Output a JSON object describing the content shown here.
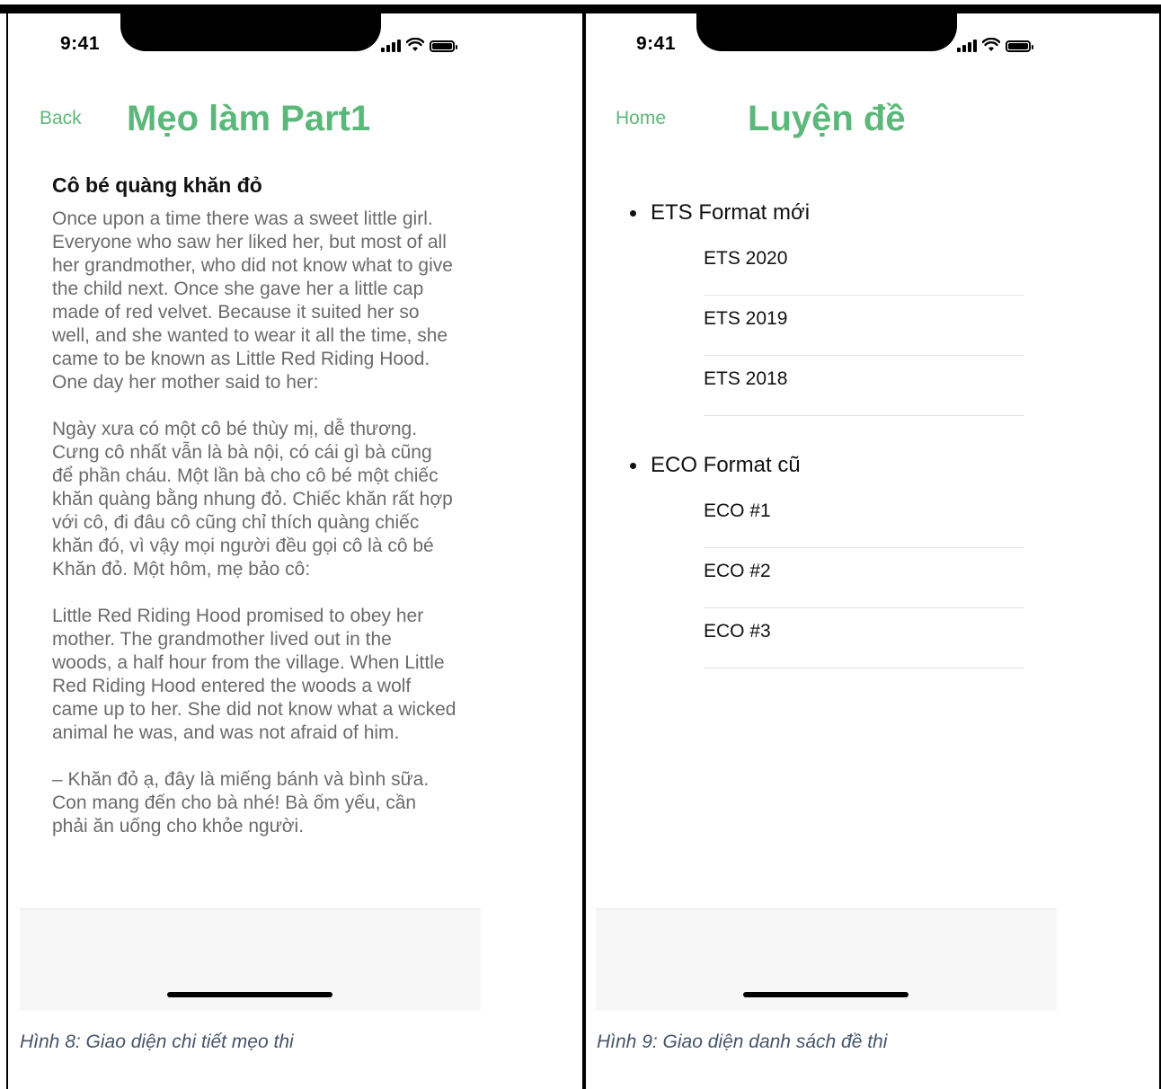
{
  "left_screen": {
    "status_time": "9:41",
    "nav_back_label": "Back",
    "nav_title": "Mẹo làm Part1",
    "article_title": "Cô bé quàng khăn đỏ",
    "paragraphs": [
      "Once upon a time there was a sweet little girl. Everyone who saw her liked her, but most of all her grandmother, who did not know what to give the child next. Once she gave her a little cap made of red velvet. Because it suited her so well, and she wanted to wear it all the time, she came to be known as Little Red Riding Hood. One day her mother said to her:",
      "Ngày xưa có một cô bé thùy mị, dễ thương. Cưng cô nhất vẫn là bà nội, có cái gì bà cũng để phần cháu. Một lần bà cho cô bé một chiếc khăn quàng bằng nhung đỏ. Chiếc khăn rất hợp với cô, đi đâu cô cũng chỉ thích quàng chiếc khăn đó, vì vậy mọi người đều gọi cô là cô bé Khăn đỏ. Một hôm, mẹ bảo cô:",
      "Little Red Riding Hood promised to obey her mother. The grandmother lived out in the woods, a half hour from the village. When Little Red Riding Hood entered the woods a wolf came up to her. She did not know what a wicked animal he was, and was not afraid of him.",
      "– Khăn đỏ ạ, đây là miếng bánh và bình sữa. Con mang đến cho bà nhé! Bà ốm yếu, cần phải ăn uống cho khỏe người."
    ]
  },
  "right_screen": {
    "status_time": "9:41",
    "nav_home_label": "Home",
    "nav_title": "Luyện đề",
    "sections": [
      {
        "title": "ETS Format mới",
        "items": [
          "ETS 2020",
          "ETS 2019",
          "ETS 2018"
        ]
      },
      {
        "title": "ECO Format cũ",
        "items": [
          "ECO #1",
          "ECO #2",
          "ECO #3"
        ]
      }
    ]
  },
  "captions": {
    "left": "Hình 8: Giao diện chi tiết mẹo thi",
    "right": "Hình 9: Giao diện danh sách đề thi"
  },
  "colors": {
    "accent": "#5cb87a",
    "body_text": "#6b6b6b",
    "caption": "#44546a"
  }
}
